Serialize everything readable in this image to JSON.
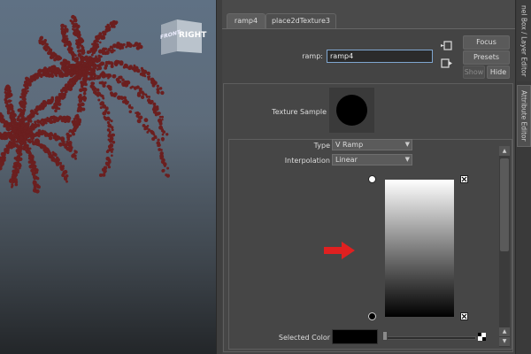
{
  "viewcube": {
    "face_label": "RIGHT",
    "side_label": "FRONT"
  },
  "editor": {
    "tabs": [
      "ramp4",
      "place2dTexture3"
    ],
    "node_label": "ramp:",
    "node_value": "ramp4",
    "buttons": {
      "focus": "Focus",
      "presets": "Presets",
      "show": "Show",
      "hide": "Hide"
    },
    "texture_sample_label": "Texture Sample",
    "type_label": "Type",
    "type_value": "V Ramp",
    "interpolation_label": "Interpolation",
    "interpolation_value": "Linear",
    "selected_color_label": "Selected Color"
  },
  "side_tabs": [
    "nel Box / Layer Editor",
    "Attribute Editor"
  ],
  "colors": {
    "particles": "#6b1f1f",
    "arrow": "#e02020"
  }
}
